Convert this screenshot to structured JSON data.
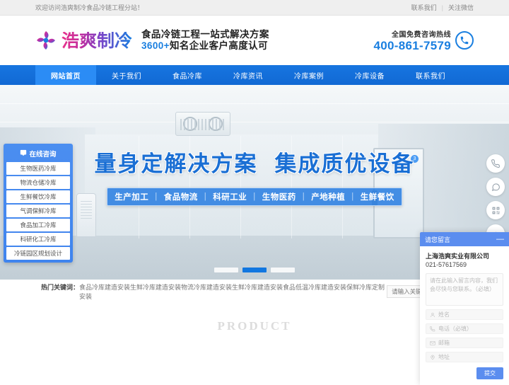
{
  "topbar": {
    "welcome": "欢迎访问浩爽制冷食品冷链工程分站！",
    "contact": "联系我们",
    "separator": "|",
    "wechat": "关注微信"
  },
  "header": {
    "logo_text": "浩爽制冷",
    "logo_icon": "snowflake-swirl-icon",
    "slogan_line1": "食品冷链工程一站式解决方案",
    "slogan_line2_num": "3600+",
    "slogan_line2_rest": "知名企业客户高度认可",
    "hotline_label": "全国免费咨询热线",
    "hotline_number": "400-861-7579",
    "phone_icon": "phone-icon",
    "accent_color": "#1a7fe0"
  },
  "nav": {
    "items": [
      {
        "label": "网站首页",
        "active": true
      },
      {
        "label": "关于我们",
        "active": false
      },
      {
        "label": "食品冷库",
        "active": false
      },
      {
        "label": "冷库资讯",
        "active": false
      },
      {
        "label": "冷库案例",
        "active": false
      },
      {
        "label": "冷库设备",
        "active": false
      },
      {
        "label": "联系我们",
        "active": false
      }
    ],
    "bg_color": "#1169d4",
    "active_color": "#2b8cf5"
  },
  "banner": {
    "headline_part1": "量身定解决方案",
    "headline_part2": "集成质优设备",
    "headline_color": "#1a6fd4",
    "tags": [
      "生产加工",
      "食品物流",
      "科研工业",
      "生物医药",
      "产地种植",
      "生鲜餐饮"
    ],
    "door_badge": "3",
    "slides_total": 3,
    "slide_active": 2
  },
  "consult": {
    "title": "在线咨询",
    "icon": "chat-icon",
    "items": [
      "生物医药冷库",
      "物流仓储冷库",
      "生鲜餐饮冷库",
      "气调保鲜冷库",
      "食品加工冷库",
      "科研化工冷库",
      "冷链园区规划设计"
    ]
  },
  "keywords": {
    "label": "热门关键词：",
    "links": "食品冷库建造安装生鲜冷库建造安装物流冷库建造安装生鲜冷库建造安装食品低温冷库建造安装保鲜冷库定制安装",
    "search_placeholder": "请输入关键字",
    "search_value": ""
  },
  "product": {
    "subtitle": "PRODUCT"
  },
  "floatbar": {
    "items": [
      {
        "name": "phone-icon"
      },
      {
        "name": "chat-icon"
      },
      {
        "name": "qrcode-icon"
      },
      {
        "name": "scroll-top-icon"
      }
    ]
  },
  "chat": {
    "title": "请您留言",
    "minimize": "—",
    "company": "上海浩爽实业有限公司",
    "phone": "021-57617569",
    "message_placeholder": "请在此输入留言内容，我们会尽快与您联系。（必填）",
    "fields": [
      {
        "icon": "user-icon",
        "placeholder": "姓名"
      },
      {
        "icon": "phone-icon",
        "placeholder": "电话（必填）"
      },
      {
        "icon": "mail-icon",
        "placeholder": "邮箱"
      },
      {
        "icon": "location-icon",
        "placeholder": "地址"
      }
    ],
    "submit_label": "提交",
    "accent_color": "#5b8def"
  }
}
